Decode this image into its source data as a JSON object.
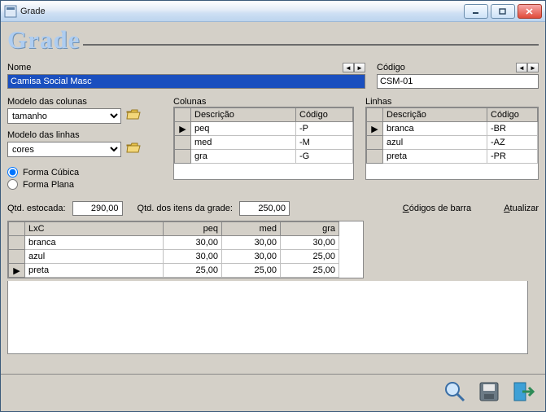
{
  "window": {
    "title": "Grade"
  },
  "header": {
    "bigtitle": "Grade"
  },
  "fields": {
    "nome": {
      "label": "Nome",
      "value": "Camisa Social Masc"
    },
    "codigo": {
      "label": "Código",
      "value": "CSM-01"
    },
    "modelo_colunas": {
      "label": "Modelo das colunas",
      "value": "tamanho"
    },
    "modelo_linhas": {
      "label": "Modelo das linhas",
      "value": "cores"
    }
  },
  "colunas": {
    "legend": "Colunas",
    "headers": {
      "desc": "Descrição",
      "cod": "Código"
    },
    "rows": [
      {
        "desc": "peq",
        "cod": "-P"
      },
      {
        "desc": "med",
        "cod": "-M"
      },
      {
        "desc": "gra",
        "cod": "-G"
      }
    ]
  },
  "linhas": {
    "legend": "Linhas",
    "headers": {
      "desc": "Descrição",
      "cod": "Código"
    },
    "rows": [
      {
        "desc": "branca",
        "cod": "-BR"
      },
      {
        "desc": "azul",
        "cod": "-AZ"
      },
      {
        "desc": "preta",
        "cod": "-PR"
      }
    ]
  },
  "forma": {
    "cubica": "Forma Cúbica",
    "plana": "Forma Plana",
    "selected": "cubica"
  },
  "quantidades": {
    "estocada_label": "Qtd. estocada:",
    "estocada_value": "290,00",
    "itens_label": "Qtd. dos itens da grade:",
    "itens_value": "250,00"
  },
  "links": {
    "codigos": "Códigos de barra",
    "atualizar": "Atualizar"
  },
  "maingrid": {
    "corner": "LxC",
    "cols": [
      "peq",
      "med",
      "gra"
    ],
    "rows": [
      {
        "label": "branca",
        "vals": [
          "30,00",
          "30,00",
          "30,00"
        ]
      },
      {
        "label": "azul",
        "vals": [
          "30,00",
          "30,00",
          "25,00"
        ]
      },
      {
        "label": "preta",
        "vals": [
          "25,00",
          "25,00",
          "25,00"
        ]
      }
    ]
  }
}
